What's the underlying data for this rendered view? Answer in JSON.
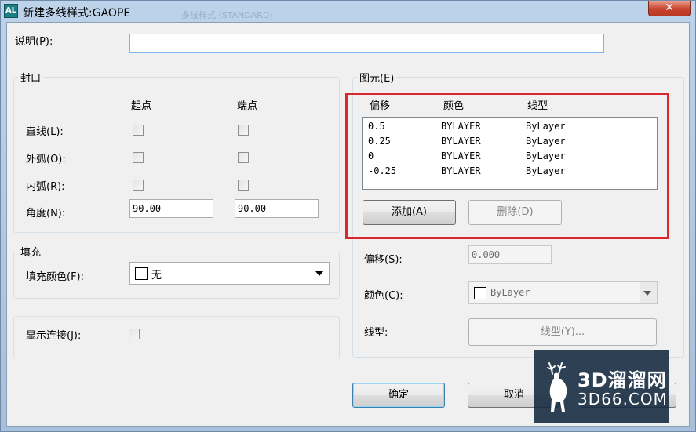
{
  "window": {
    "title": "新建多线样式:GAOPE",
    "app_icon_text": "AL",
    "close_symbol": "✕",
    "ghost_title": "多线样式 (STANDARD)"
  },
  "description": {
    "label": "说明(P):",
    "value": ""
  },
  "caps": {
    "title": "封口",
    "col_start": "起点",
    "col_end": "端点",
    "rows": [
      {
        "label": "直线(L):",
        "start_checked": false,
        "end_checked": false
      },
      {
        "label": "外弧(O):",
        "start_checked": false,
        "end_checked": false
      },
      {
        "label": "内弧(R):",
        "start_checked": false,
        "end_checked": false
      }
    ],
    "angle_label": "角度(N):",
    "angle_start": "90.00",
    "angle_end": "90.00"
  },
  "fill": {
    "title": "填充",
    "color_label": "填充颜色(F):",
    "color_value": "无",
    "swatch_color": "#ffffff"
  },
  "joints": {
    "label": "显示连接(J):",
    "checked": false
  },
  "elements": {
    "title": "图元(E)",
    "headers": {
      "offset": "偏移",
      "color": "颜色",
      "linetype": "线型"
    },
    "rows": [
      {
        "offset": "0.5",
        "color": "BYLAYER",
        "linetype": "ByLayer"
      },
      {
        "offset": "0.25",
        "color": "BYLAYER",
        "linetype": "ByLayer"
      },
      {
        "offset": "0",
        "color": "BYLAYER",
        "linetype": "ByLayer"
      },
      {
        "offset": "-0.25",
        "color": "BYLAYER",
        "linetype": "ByLayer"
      }
    ],
    "add_button": "添加(A)",
    "delete_button": "删除(D)",
    "offset_label": "偏移(S):",
    "offset_value": "0.000",
    "color_label": "颜色(C):",
    "color_value": "ByLayer",
    "linetype_label": "线型:",
    "linetype_button": "线型(Y)..."
  },
  "buttons": {
    "ok": "确定",
    "cancel": "取消"
  },
  "watermark": {
    "line1": "3D溜溜网",
    "line2": "3D66.COM"
  },
  "colors": {
    "highlight": "#d9272a",
    "accent": "#3c7fb1",
    "titlebar": "#bcd3ea"
  }
}
